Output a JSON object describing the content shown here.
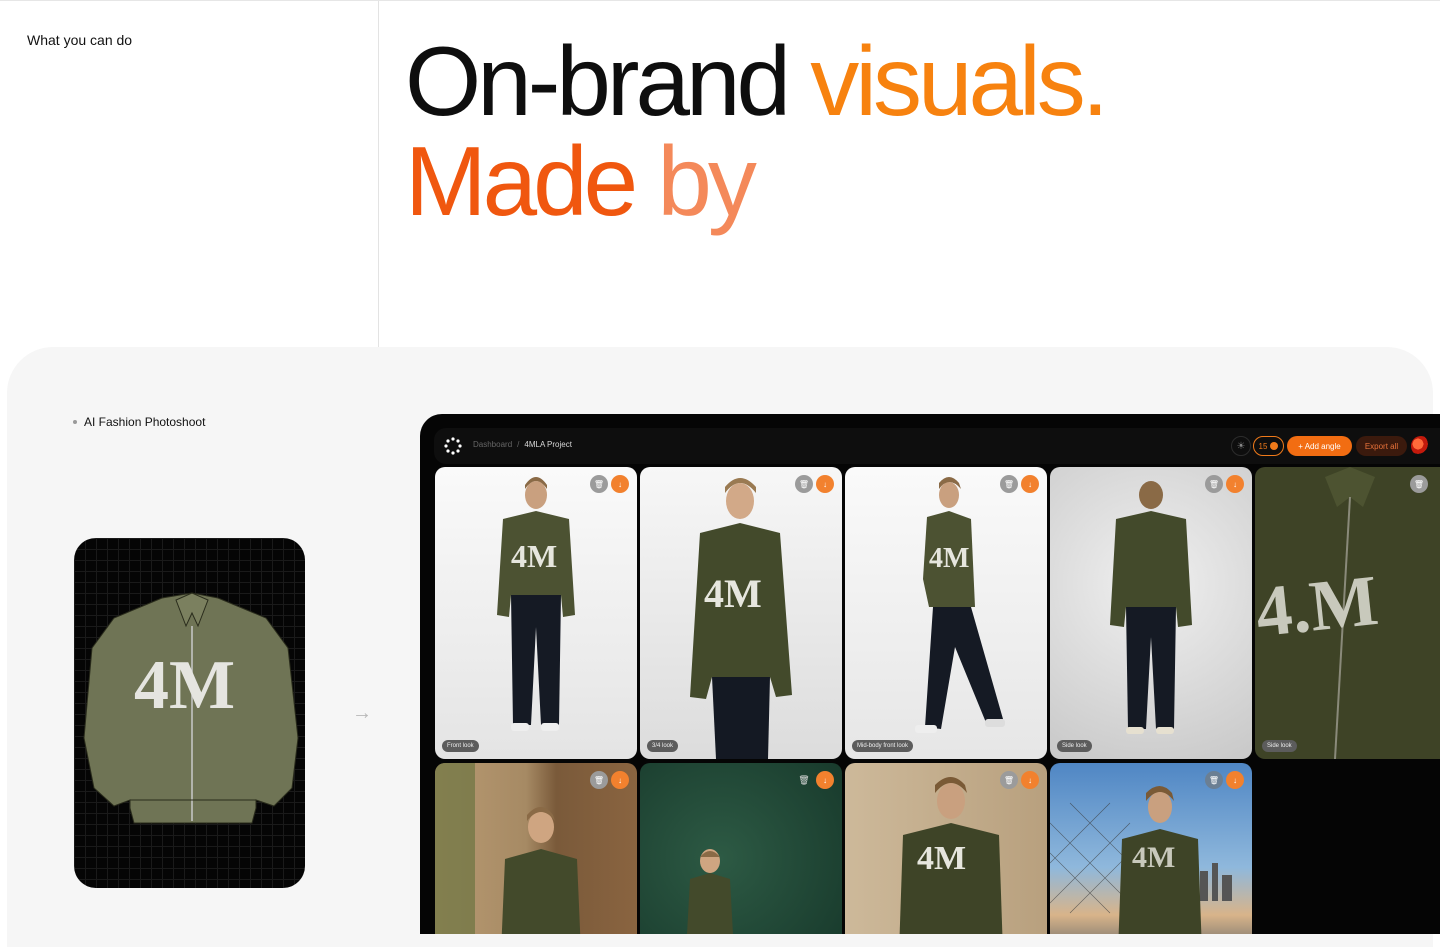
{
  "section": {
    "eyebrow": "What you can do"
  },
  "hero": {
    "line1_a": "On-brand ",
    "line1_b": "visuals.",
    "line2_a": "Made ",
    "line2_b": "by"
  },
  "feature": {
    "tag": "AI Fashion Photoshoot",
    "arrow": "→"
  },
  "app": {
    "breadcrumb": {
      "root": "Dashboard",
      "sep": "/",
      "current": "4MLA Project"
    },
    "credits": "15",
    "add_angle": "+ Add angle",
    "export_all": "Export all",
    "icons": {
      "theme": "sun-icon",
      "delete": "trash-icon",
      "download": "download-icon",
      "logo": "spinner-logo-icon"
    },
    "row1": [
      {
        "label": "Front look"
      },
      {
        "label": "3/4 look"
      },
      {
        "label": "Mid-body front look"
      },
      {
        "label": "Side look"
      },
      {
        "label": "Side look"
      }
    ],
    "row2": [
      {
        "label": ""
      },
      {
        "label": ""
      },
      {
        "label": ""
      },
      {
        "label": ""
      }
    ]
  },
  "colors": {
    "accent": "#f26d12",
    "orange": "#f7820f",
    "red_orange": "#f0570f",
    "peach": "#f4895a",
    "jacket": "#4a4e2f"
  }
}
